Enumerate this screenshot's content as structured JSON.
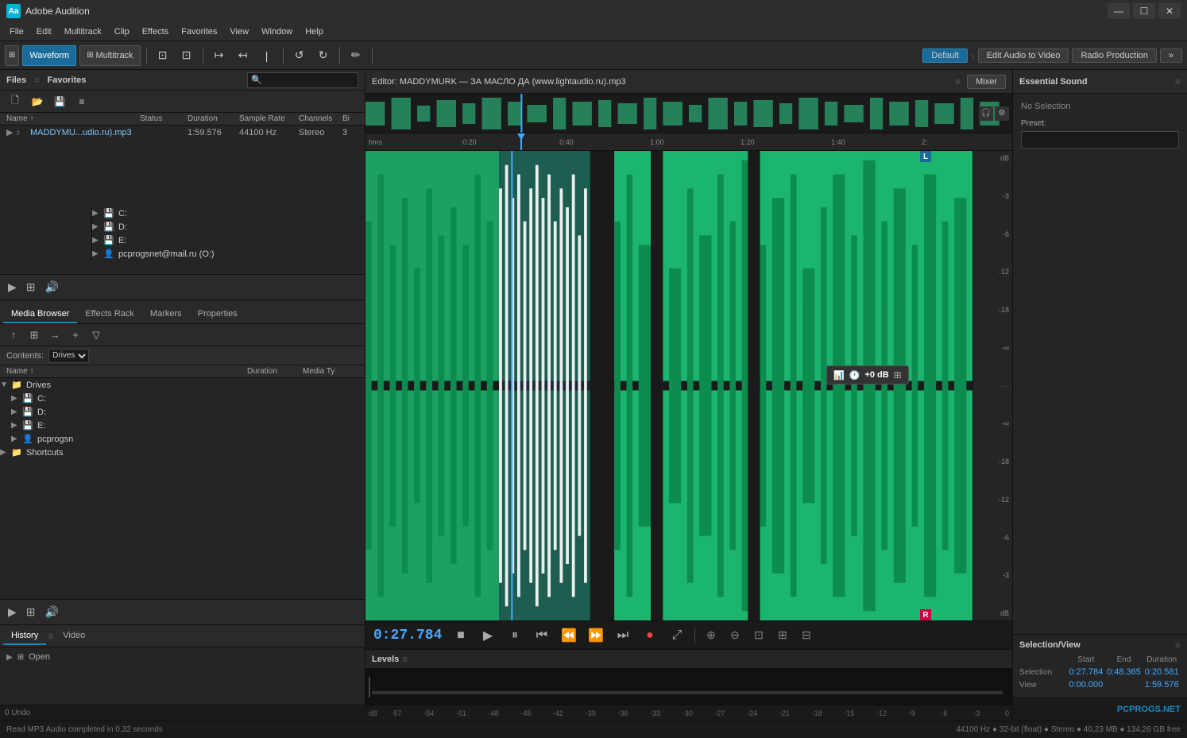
{
  "app": {
    "title": "Adobe Audition",
    "logo_text": "Aa"
  },
  "titlebar": {
    "title": "Adobe Audition",
    "minimize": "—",
    "maximize": "☐",
    "close": "✕"
  },
  "menubar": {
    "items": [
      "File",
      "Edit",
      "Multitrack",
      "Clip",
      "Effects",
      "Favorites",
      "View",
      "Window",
      "Help"
    ]
  },
  "toolbar": {
    "waveform_label": "Waveform",
    "multitrack_label": "Multitrack",
    "workspace_default": "Default",
    "workspace_edit_audio": "Edit Audio to Video",
    "workspace_radio": "Radio Production",
    "workspace_more": "»"
  },
  "files_panel": {
    "title": "Files",
    "favorites_label": "Favorites",
    "columns": [
      "Name ↑",
      "Status",
      "Duration",
      "Sample Rate",
      "Channels",
      "Bi"
    ],
    "files": [
      {
        "name": "MADDYMU...udio.ru).mp3",
        "status": "",
        "duration": "1:59.576",
        "sample_rate": "44100 Hz",
        "channels": "Stereo",
        "bit": "3"
      }
    ]
  },
  "editor": {
    "title": "Editor: MADDYMURK — ЗА МАСЛО ДА (www.lightaudio.ru).mp3",
    "mixer_label": "Mixer",
    "time_display": "0:27.784",
    "rulers": [
      "hms",
      "0:20",
      "0:40",
      "1:00",
      "1:20",
      "1:40",
      "2:"
    ],
    "selection_popup": {
      "volume": "+0 dB"
    }
  },
  "transport": {
    "stop": "■",
    "play": "▶",
    "pause": "⏸",
    "prev": "⏮",
    "rwd": "⏪",
    "fwd": "⏩",
    "next": "⏭",
    "record": "●",
    "loop": "🔁",
    "time": "0:27.784"
  },
  "db_scale": {
    "top_values": [
      "dB",
      "-3",
      "-6",
      "-12",
      "-18",
      "-∞"
    ],
    "bottom_values": [
      "dB",
      "-3",
      "-6",
      "-12",
      "-18",
      "-∞"
    ]
  },
  "media_browser": {
    "title": "Media Browser",
    "tabs": [
      "Media Browser",
      "Effects Rack",
      "Markers",
      "Properties"
    ],
    "contents_label": "Contents:",
    "contents_value": "Drives",
    "columns": [
      "Name ↑",
      "Duration",
      "Media Ty"
    ],
    "drives": [
      {
        "label": "Drives",
        "expanded": true
      },
      {
        "label": "C:",
        "indent": 1
      },
      {
        "label": "D:",
        "indent": 1
      },
      {
        "label": "E:",
        "indent": 1
      },
      {
        "label": "pcprogsn",
        "indent": 1
      },
      {
        "label": "Shortcuts",
        "indent": 0,
        "expanded": false
      }
    ],
    "file_entries": [
      {
        "label": "C:",
        "indent": 1
      },
      {
        "label": "D:",
        "indent": 1
      },
      {
        "label": "E:",
        "indent": 1
      },
      {
        "label": "pcprogsnet@mail.ru (O:)",
        "indent": 1
      }
    ]
  },
  "history": {
    "title": "History",
    "video_tab": "Video",
    "items": [
      {
        "icon": "▶",
        "label": "Open"
      }
    ]
  },
  "essential_sound": {
    "title": "Essential Sound",
    "no_selection": "No Selection",
    "preset_label": "Preset:"
  },
  "selection_view": {
    "title": "Selection/View",
    "headers": [
      "Start",
      "End",
      "Duration"
    ],
    "selection_label": "Selection",
    "view_label": "View",
    "selection_values": [
      "0:27.784",
      "0:48.365",
      "0:20.581"
    ],
    "view_values": [
      "0:00.000",
      "",
      "1:59.576"
    ]
  },
  "levels": {
    "title": "Levels",
    "ruler_values": [
      "dB",
      "-57",
      "-54",
      "-51",
      "-48",
      "-45",
      "-42",
      "-39",
      "-36",
      "-33",
      "-30",
      "-27",
      "-24",
      "-21",
      "-18",
      "-15",
      "-12",
      "-9",
      "-6",
      "-3",
      "0"
    ]
  },
  "status_bar": {
    "undo_label": "0 Undo",
    "status_msg": "Read MP3 Audio completed in 0,32 seconds",
    "info": "44100 Hz ● 32-bit (float) ● Stereo ● 40,23 MB ● 134,26 GB free",
    "brand": "PCPROGS.NET"
  }
}
